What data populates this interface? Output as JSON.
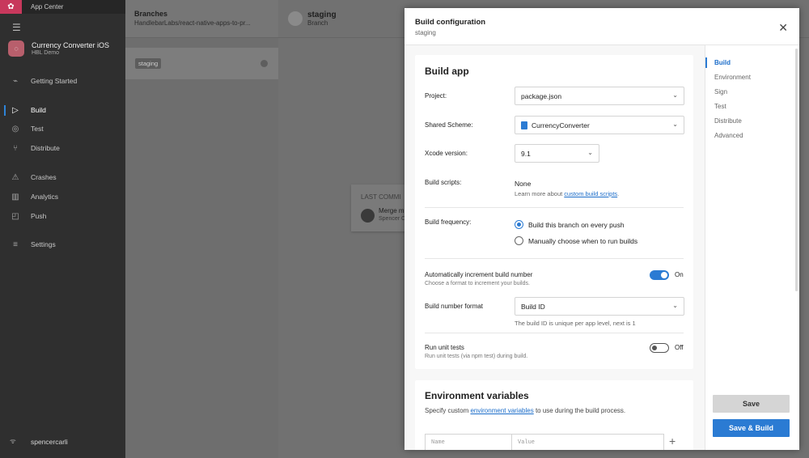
{
  "app": {
    "name": "App Center"
  },
  "project": {
    "title": "Currency Converter iOS",
    "org": "HBL Demo"
  },
  "nav": {
    "items": [
      {
        "label": "Getting Started",
        "icon": "rocket-icon"
      },
      {
        "label": "Build",
        "icon": "play-triangle-icon"
      },
      {
        "label": "Test",
        "icon": "check-circle-icon"
      },
      {
        "label": "Distribute",
        "icon": "distribute-icon"
      },
      {
        "label": "Crashes",
        "icon": "warning-icon"
      },
      {
        "label": "Analytics",
        "icon": "bar-chart-icon"
      },
      {
        "label": "Push",
        "icon": "push-icon"
      },
      {
        "label": "Settings",
        "icon": "sliders-icon"
      }
    ],
    "active": "Build",
    "user": "spencercarli"
  },
  "branches": {
    "title": "Branches",
    "repo": "HandlebarLabs/react-native-apps-to-pr...",
    "selected_branch": "staging"
  },
  "main": {
    "branch": "staging",
    "branch_sub": "Branch",
    "commit": {
      "label": "LAST COMMI",
      "message": "Merge m",
      "author": "Spencer C"
    }
  },
  "panel": {
    "title": "Build configuration",
    "subtitle": "staging",
    "build_app": {
      "heading": "Build app",
      "project_label": "Project:",
      "project_value": "package.json",
      "scheme_label": "Shared Scheme:",
      "scheme_value": "CurrencyConverter",
      "xcode_label": "Xcode version:",
      "xcode_value": "9.1",
      "scripts_label": "Build scripts:",
      "scripts_value": "None",
      "scripts_hint_pre": "Learn more about ",
      "scripts_hint_link": "custom build scripts",
      "scripts_hint_post": ".",
      "frequency_label": "Build frequency:",
      "frequency_opt1": "Build this branch on every push",
      "frequency_opt2": "Manually choose when to run builds",
      "auto_inc_label": "Automatically increment build number",
      "auto_inc_sub": "Choose a format to increment your builds.",
      "auto_inc_state": "On",
      "number_format_label": "Build number format",
      "number_format_value": "Build ID",
      "number_format_hint": "The build ID is unique per app level, next is 1",
      "unit_tests_label": "Run unit tests",
      "unit_tests_sub": "Run unit tests (via npm test) during build.",
      "unit_tests_state": "Off"
    },
    "env": {
      "heading": "Environment variables",
      "desc_pre": "Specify custom ",
      "desc_link": "environment variables",
      "desc_post": " to use during the build process.",
      "name_placeholder": "Name",
      "value_placeholder": "Value"
    },
    "toc": [
      "Build",
      "Environment",
      "Sign",
      "Test",
      "Distribute",
      "Advanced"
    ],
    "save_label": "Save",
    "save_build_label": "Save & Build"
  }
}
